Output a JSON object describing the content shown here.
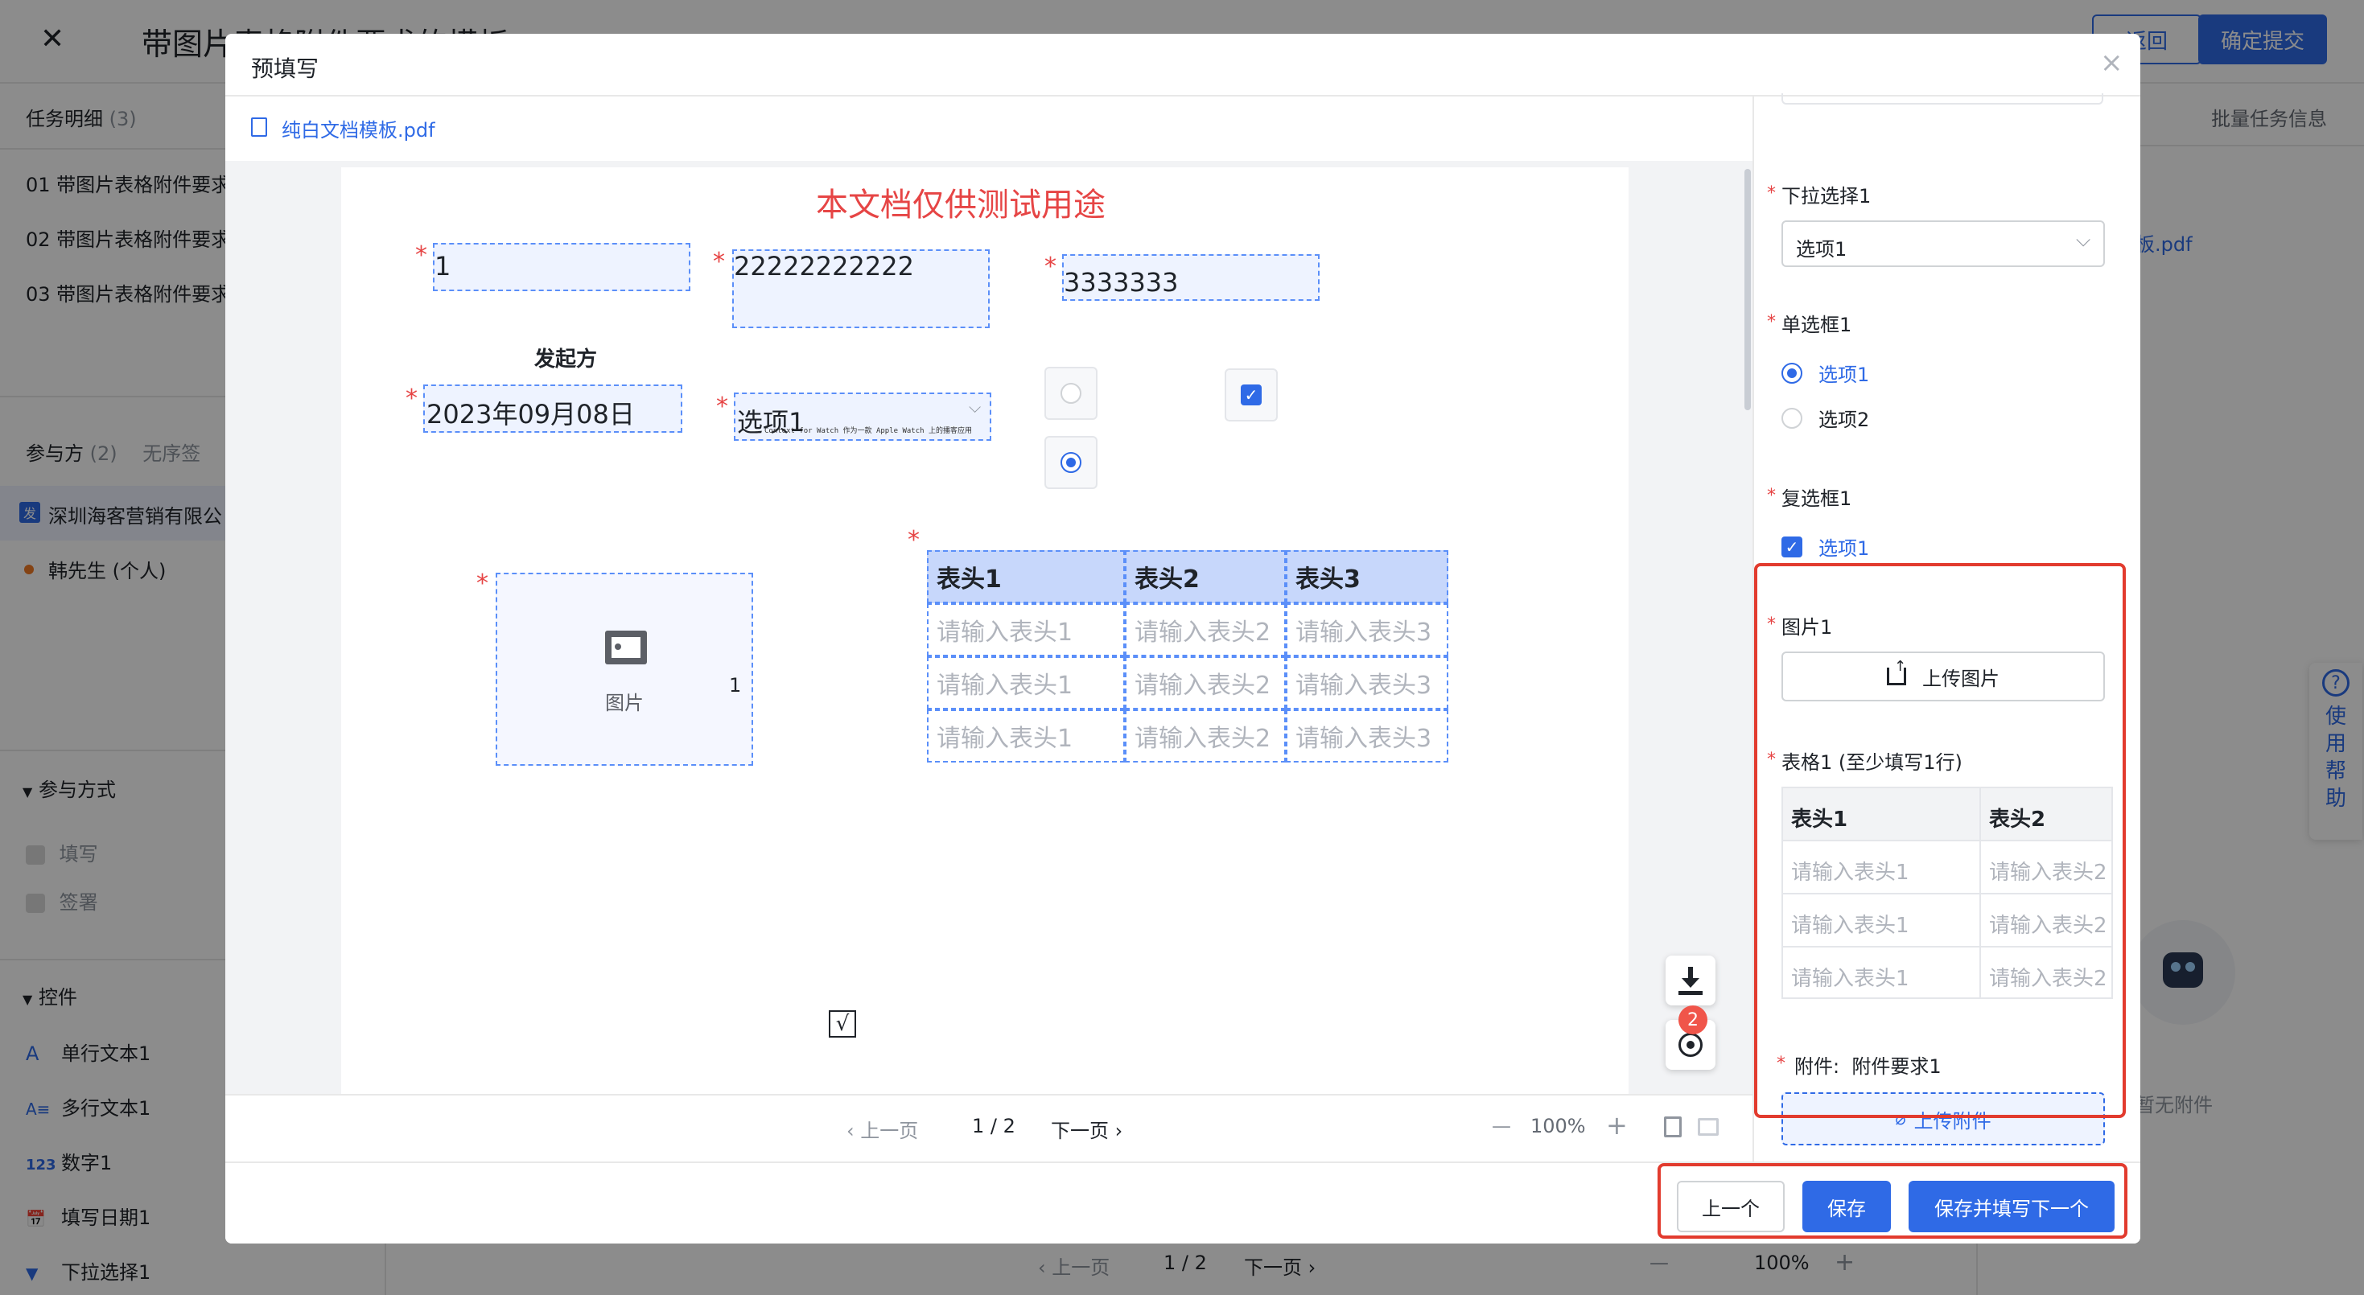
{
  "background": {
    "title": "带图片表格附件要求的模板",
    "close_glyph": "✕",
    "return_label": "返回",
    "confirm_label": "确定提交",
    "task_tab": "任务明细",
    "task_count": "(3)",
    "tasks": [
      "01 带图片表格附件要求",
      "02 带图片表格附件要求",
      "03 带图片表格附件要求"
    ],
    "participants_label": "参与方",
    "participants_count": "(2)",
    "unordered_label": "无序签",
    "participants": [
      {
        "badge": "发",
        "name": "深圳海客营销有限公"
      },
      {
        "badge": "",
        "name": "韩先生 (个人)"
      }
    ],
    "participation_mode_label": "参与方式",
    "modes": [
      "填写",
      "签署"
    ],
    "controls_label": "控件",
    "controls": [
      {
        "icon": "A",
        "label": "单行文本1"
      },
      {
        "icon": "A≡",
        "label": "多行文本1"
      },
      {
        "icon": "123",
        "label": "数字1"
      },
      {
        "icon": "📅",
        "label": "填写日期1"
      },
      {
        "icon": "▼",
        "label": "下拉选择1"
      }
    ],
    "batch_tab": "批量任务信息",
    "right_file": "板.pdf",
    "no_attachment": "暂无附件",
    "help_label": "使用帮助",
    "bottom_pager": {
      "prev": "上一页",
      "page": "1 / 2",
      "next": "下一页",
      "zoom": "100%"
    }
  },
  "modal": {
    "title": "预填写",
    "file_name": "纯白文档模板.pdf",
    "doc": {
      "watermark_title": "本文档仅供测试用途",
      "field_text1": "1",
      "field_text2": "22222222222",
      "field_text3": "3333333",
      "initiator_label": "发起方",
      "date_value": "2023年09月08日",
      "select_value": "选项1",
      "tiny_text": "Context for Watch 作为一款 Apple Watch 上的播客应用",
      "image_label": "图片",
      "image_side_num": "1",
      "table_headers": [
        "表头1",
        "表头2",
        "表头3"
      ],
      "table_rows": [
        [
          "请输入表头1",
          "请输入表头2",
          "请输入表头3"
        ],
        [
          "请输入表头1",
          "请输入表头2",
          "请输入表头3"
        ],
        [
          "请输入表头1",
          "请输入表头2",
          "请输入表头3"
        ]
      ],
      "check_mark": "√"
    },
    "badge_count": "2",
    "pager": {
      "prev": "上一页",
      "page": "1 / 2",
      "next": "下一页",
      "zoom": "100%"
    },
    "right_panel": {
      "dropdown_label": "下拉选择1",
      "dropdown_value": "选项1",
      "radio_label": "单选框1",
      "radio_options": [
        "选项1",
        "选项2"
      ],
      "checkbox_label": "复选框1",
      "checkbox_options": [
        "选项1"
      ],
      "image_label": "图片1",
      "upload_image": "上传图片",
      "table_label": "表格1 (至少填写1行)",
      "table_headers": [
        "表头1",
        "表头2"
      ],
      "table_rows": [
        [
          "请输入表头1",
          "请输入表头2"
        ],
        [
          "请输入表头1",
          "请输入表头2"
        ],
        [
          "请输入表头1",
          "请输入表头2"
        ]
      ],
      "attachment_label": "附件:  附件要求1",
      "upload_attachment": "上传附件"
    },
    "footer": {
      "prev": "上一个",
      "save": "保存",
      "save_next": "保存并填写下一个"
    }
  },
  "colors": {
    "accent": "#2f6ae6",
    "required": "#e64545",
    "highlight": "#e23b2e",
    "field_fill": "#eef3ff"
  }
}
